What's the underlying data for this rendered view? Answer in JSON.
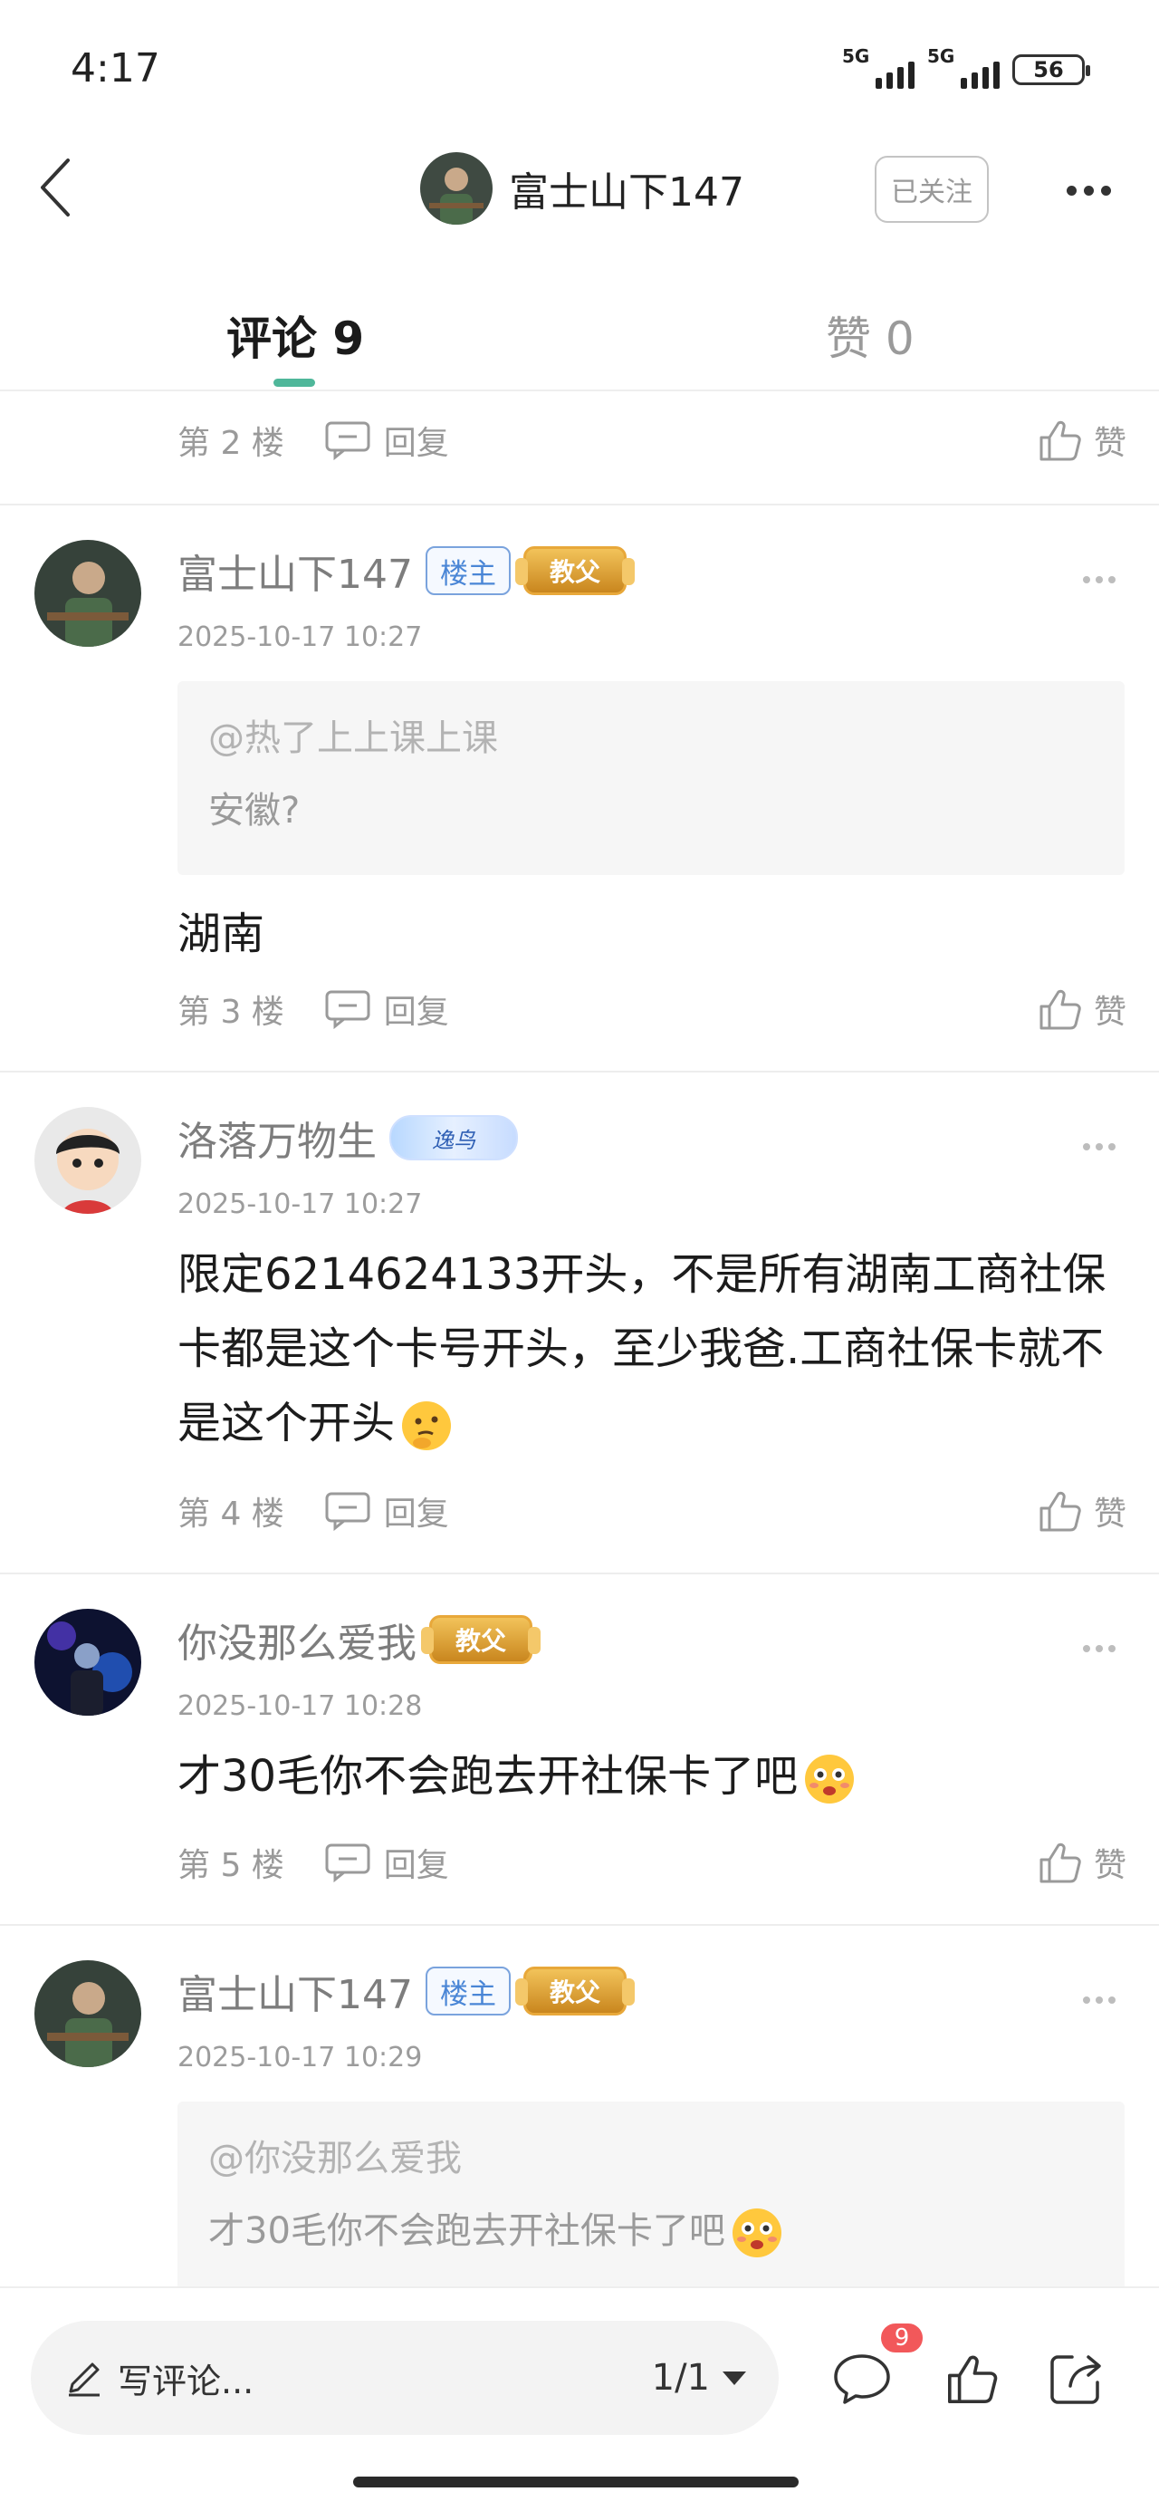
{
  "status_bar": {
    "time": "4:17",
    "network1": "5G",
    "network2": "5G",
    "battery": "56"
  },
  "header": {
    "title": "富士山下147",
    "follow_label": "已关注"
  },
  "tabs": [
    {
      "label": "评论 9",
      "active": true
    },
    {
      "label": "赞 0",
      "active": false
    }
  ],
  "top_partial": {
    "floor": "第 2 楼",
    "reply": "回复",
    "like": "赞"
  },
  "posts": [
    {
      "username": "富士山下147",
      "badges": [
        "楼主",
        "教父"
      ],
      "timestamp": "2025-10-17 10:27",
      "quote_user": "@热了上上课上课",
      "quote_text": "安徽?",
      "content": "湖南",
      "floor": "第 3 楼",
      "reply": "回复",
      "like": "赞"
    },
    {
      "username": "洛落万物生",
      "badges": [
        "逸鸟"
      ],
      "timestamp": "2025-10-17 10:27",
      "content": "限定6214624133开头，不是所有湖南工商社保卡都是这个卡号开头，至少我爸.工商社保卡就不是这个开头",
      "emoji": "thinking-face",
      "floor": "第 4 楼",
      "reply": "回复",
      "like": "赞"
    },
    {
      "username": "你没那么爱我",
      "badges": [
        "教父"
      ],
      "timestamp": "2025-10-17 10:28",
      "content": "才30毛你不会跑去开社保卡了吧",
      "emoji": "flushed-face",
      "floor": "第 5 楼",
      "reply": "回复",
      "like": "赞"
    },
    {
      "username": "富士山下147",
      "badges": [
        "楼主",
        "教父"
      ],
      "timestamp": "2025-10-17 10:29",
      "quote_user": "@你没那么爱我",
      "quote_text": "才30毛你不会跑去开社保卡了吧",
      "emoji": "flushed-face"
    }
  ],
  "bottom_bar": {
    "comment_placeholder": "写评论...",
    "page": "1/1",
    "comment_count": "9"
  },
  "colors": {
    "accent": "#4fb79a",
    "owner_badge": "#4a86d6",
    "notify": "#f2585a"
  }
}
